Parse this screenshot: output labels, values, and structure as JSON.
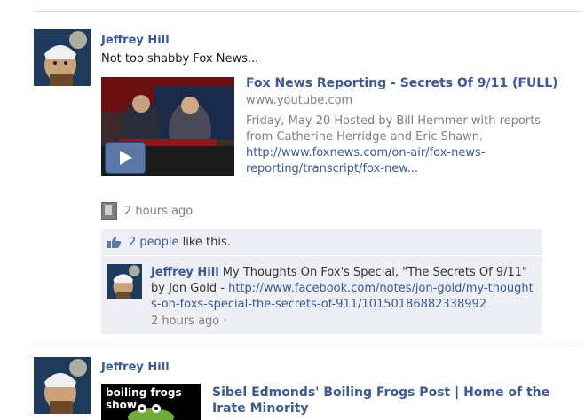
{
  "post1": {
    "author": "Jeffrey Hill",
    "message": "Not too shabby Fox News...",
    "attachment": {
      "title": "Fox News Reporting - Secrets Of 9/11 (FULL)",
      "domain": "www.youtube.com",
      "description": "Friday, May 20 Hosted by Bill Hemmer with reports from Catherine Herridge and Eric Shawn.",
      "link": "http://www.foxnews.com/on-air/fox-news-reporting/transcript/fox-new..."
    },
    "timestamp": "2 hours ago",
    "likes": {
      "count_text": "2 people",
      "suffix": " like this."
    },
    "comment": {
      "author": "Jeffrey Hill",
      "text": " My Thoughts On Fox's Special, \"The Secrets Of 9/11\" by Jon Gold - ",
      "link": "http://www.facebook.com/notes/jon-gold/my-thoughts-on-foxs-special-the-secrets-of-911/10150186882338992",
      "timestamp": "2 hours ago",
      "separator": "·"
    }
  },
  "post2": {
    "author": "Jeffrey Hill",
    "thumbnail_text": "boiling frogs show",
    "attachment_title": "Sibel Edmonds' Boiling Frogs Post | Home of the Irate Minority"
  },
  "colors": {
    "link": "#3b5998",
    "muted": "#808080",
    "panel": "#edeff4"
  }
}
